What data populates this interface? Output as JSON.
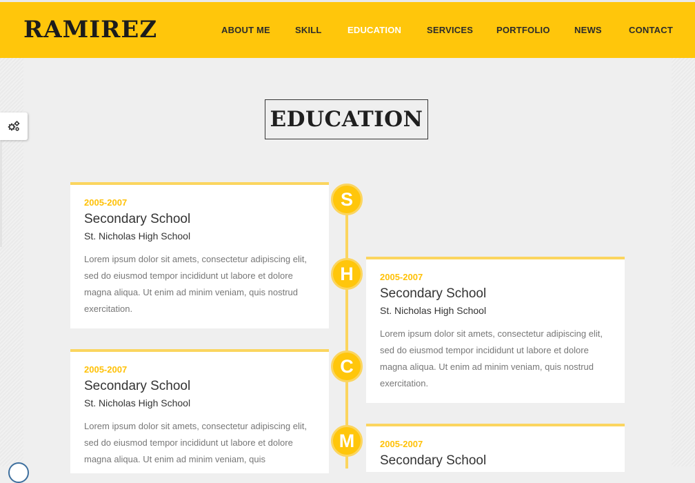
{
  "brand": {
    "logo": "RAMIREZ"
  },
  "nav": {
    "items": [
      "ABOUT ME",
      "SKILL",
      "EDUCATION",
      "SERVICES",
      "PORTFOLIO",
      "NEWS",
      "CONTACT"
    ],
    "active": "EDUCATION"
  },
  "section": {
    "title": "EDUCATION"
  },
  "timeline": [
    {
      "marker": "S",
      "year": "2005-2007",
      "title": "Secondary School",
      "school": "St. Nicholas High School",
      "desc": "Lorem ipsum dolor sit amets, consectetur adipiscing elit, sed do eiusmod tempor incididunt ut labore et dolore magna aliqua. Ut enim ad minim veniam, quis nostrud exercitation."
    },
    {
      "marker": "H",
      "year": "2005-2007",
      "title": "Secondary School",
      "school": "St. Nicholas High School",
      "desc": "Lorem ipsum dolor sit amets, consectetur adipiscing elit, sed do eiusmod tempor incididunt ut labore et dolore magna aliqua. Ut enim ad minim veniam, quis nostrud exercitation."
    },
    {
      "marker": "C",
      "year": "2005-2007",
      "title": "Secondary School",
      "school": "St. Nicholas High School",
      "desc": "Lorem ipsum dolor sit amets, consectetur adipiscing elit, sed do eiusmod tempor incididunt ut labore et dolore magna aliqua. Ut enim ad minim veniam, quis"
    },
    {
      "marker": "M",
      "year": "2005-2007",
      "title": "Secondary School",
      "school": "",
      "desc": ""
    }
  ],
  "colors": {
    "accent": "#ffc60b",
    "line": "#fbd55f",
    "year_text": "#ffc107"
  },
  "icons": {
    "settings": "gears-icon"
  }
}
